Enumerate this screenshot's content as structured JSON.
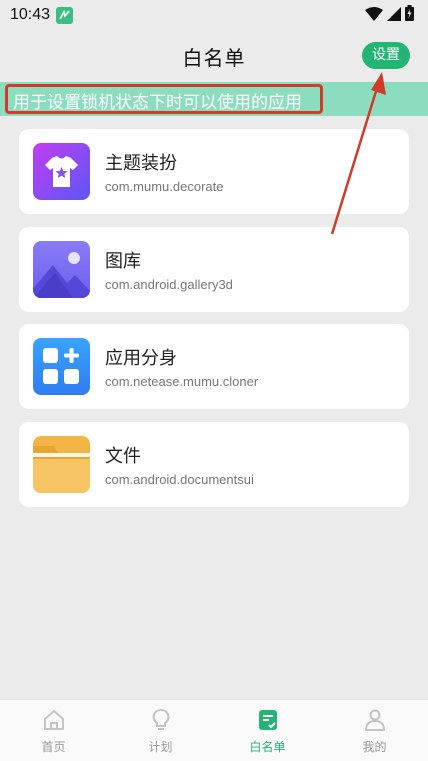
{
  "status_bar": {
    "time": "10:43"
  },
  "header": {
    "title": "白名单",
    "settings_label": "设置"
  },
  "banner": {
    "text": "用于设置锁机状态下时可以使用的应用"
  },
  "apps": [
    {
      "name": "主题装扮",
      "package": "com.mumu.decorate",
      "icon": "tshirt-star-icon"
    },
    {
      "name": "图库",
      "package": "com.android.gallery3d",
      "icon": "gallery-icon"
    },
    {
      "name": "应用分身",
      "package": "com.netease.mumu.cloner",
      "icon": "app-cloner-icon"
    },
    {
      "name": "文件",
      "package": "com.android.documentsui",
      "icon": "folder-icon"
    }
  ],
  "bottom_nav": [
    {
      "label": "首页",
      "icon": "home-icon",
      "active": false
    },
    {
      "label": "计划",
      "icon": "lightbulb-icon",
      "active": false
    },
    {
      "label": "白名单",
      "icon": "whitelist-doc-icon",
      "active": true
    },
    {
      "label": "我的",
      "icon": "person-icon",
      "active": false
    }
  ],
  "colors": {
    "accent": "#23b574",
    "banner_bg": "#8cdcc0",
    "highlight": "#d23a2a",
    "background": "#ebebeb"
  }
}
